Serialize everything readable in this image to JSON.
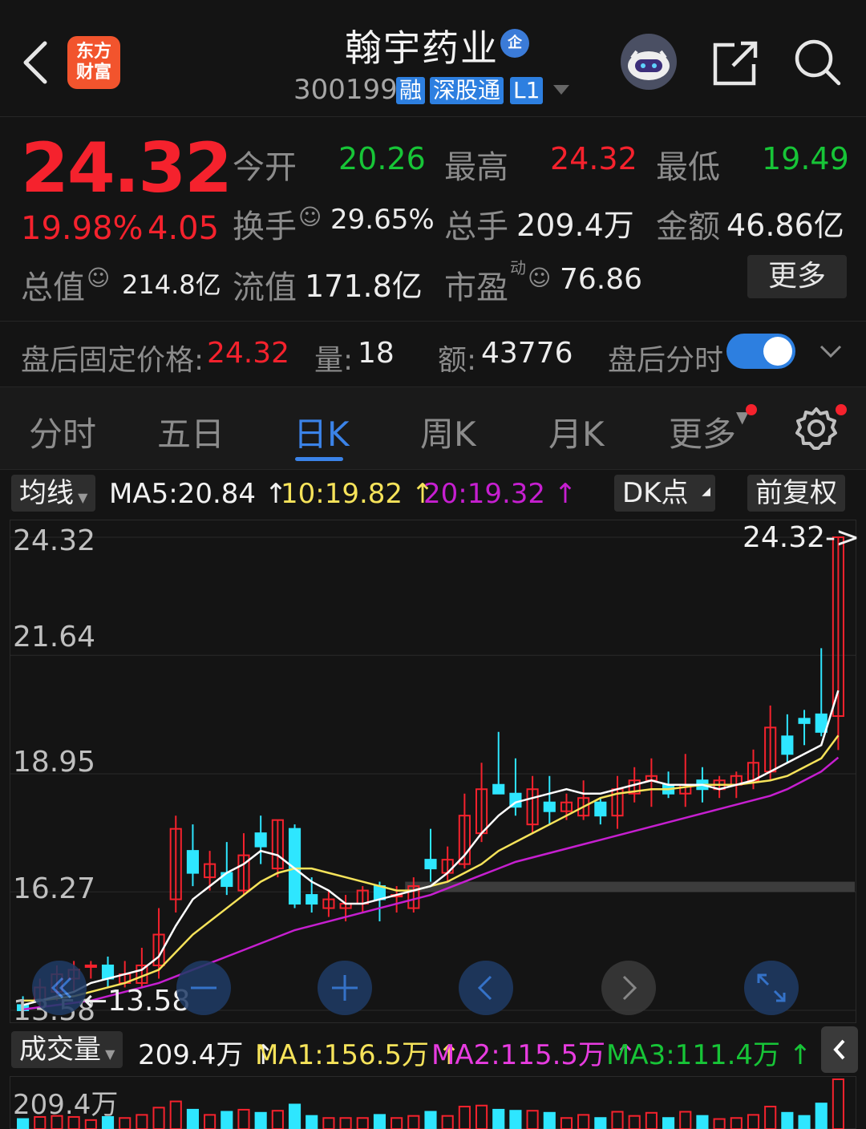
{
  "header": {
    "stock_name": "翰宇药业",
    "qi_badge": "企",
    "code": "300199",
    "tags": [
      "融",
      "深股通",
      "L1"
    ],
    "logo_line1": "东方",
    "logo_line2": "财富"
  },
  "quote": {
    "price": "24.32",
    "change_pct": "19.98%",
    "change": "4.05",
    "open_label": "今开",
    "open": "20.26",
    "high_label": "最高",
    "high": "24.32",
    "low_label": "最低",
    "low": "19.49",
    "turnover_label": "换手",
    "turnover": "29.65%",
    "volume_label": "总手",
    "volume": "209.4万",
    "amount_label": "金额",
    "amount": "46.86亿",
    "mktcap_label": "总值",
    "mktcap": "214.8亿",
    "float_label": "流值",
    "float": "171.8亿",
    "pe_label": "市盈",
    "pe_sup": "动",
    "pe": "76.86",
    "more": "更多"
  },
  "after_hours": {
    "label": "盘后固定价格:",
    "price": "24.32",
    "vol_label": "量:",
    "vol": "18",
    "amt_label": "额:",
    "amt": "43776",
    "toggle_label": "盘后分时",
    "toggle_on": true
  },
  "tabs": [
    "分时",
    "五日",
    "日K",
    "周K",
    "月K",
    "更多"
  ],
  "active_tab": "日K",
  "ma": {
    "selector": "均线",
    "ma5": "MA5:20.84",
    "ma10": "10:19.82",
    "ma20": "20:19.32",
    "dk": "DK点",
    "adjust": "前复权"
  },
  "colors": {
    "up": "#f5222d",
    "down": "#17c537",
    "bear_candle": "#2ee6ff",
    "ma5": "#ffffff",
    "ma10": "#f6e35a",
    "ma20": "#c61fd0",
    "accent": "#2d7fe0"
  },
  "chart_data": {
    "type": "candlestick",
    "y_ticks": [
      "24.32",
      "21.64",
      "18.95",
      "16.27",
      "13.58"
    ],
    "ylim": [
      13.58,
      24.32
    ],
    "last_label": "24.32->",
    "low_label": "13.58",
    "candles": [
      {
        "o": 13.7,
        "h": 13.9,
        "l": 13.4,
        "c": 13.58
      },
      {
        "o": 13.8,
        "h": 14.3,
        "l": 13.6,
        "c": 14.1
      },
      {
        "o": 14.0,
        "h": 14.6,
        "l": 13.8,
        "c": 14.4
      },
      {
        "o": 14.3,
        "h": 14.7,
        "l": 14.0,
        "c": 14.5
      },
      {
        "o": 14.6,
        "h": 14.7,
        "l": 14.3,
        "c": 14.6
      },
      {
        "o": 14.6,
        "h": 14.8,
        "l": 14.1,
        "c": 14.3
      },
      {
        "o": 14.2,
        "h": 14.7,
        "l": 14.1,
        "c": 14.4
      },
      {
        "o": 14.2,
        "h": 15.0,
        "l": 14.1,
        "c": 14.6
      },
      {
        "o": 14.6,
        "h": 15.9,
        "l": 14.3,
        "c": 15.3
      },
      {
        "o": 16.1,
        "h": 18.0,
        "l": 15.8,
        "c": 17.7
      },
      {
        "o": 17.2,
        "h": 17.8,
        "l": 16.4,
        "c": 16.7
      },
      {
        "o": 16.6,
        "h": 17.2,
        "l": 16.3,
        "c": 16.9
      },
      {
        "o": 16.7,
        "h": 17.4,
        "l": 16.2,
        "c": 16.4
      },
      {
        "o": 16.3,
        "h": 17.6,
        "l": 16.2,
        "c": 17.1
      },
      {
        "o": 17.6,
        "h": 18.0,
        "l": 16.9,
        "c": 17.3
      },
      {
        "o": 16.8,
        "h": 17.9,
        "l": 16.6,
        "c": 17.9
      },
      {
        "o": 17.7,
        "h": 17.8,
        "l": 15.9,
        "c": 16.0
      },
      {
        "o": 16.2,
        "h": 16.6,
        "l": 15.8,
        "c": 16.0
      },
      {
        "o": 15.9,
        "h": 16.3,
        "l": 15.7,
        "c": 16.1
      },
      {
        "o": 15.9,
        "h": 16.2,
        "l": 15.6,
        "c": 16.0
      },
      {
        "o": 16.0,
        "h": 16.4,
        "l": 15.8,
        "c": 16.3
      },
      {
        "o": 16.4,
        "h": 16.5,
        "l": 15.6,
        "c": 16.1
      },
      {
        "o": 16.2,
        "h": 16.4,
        "l": 15.8,
        "c": 16.2
      },
      {
        "o": 15.9,
        "h": 16.6,
        "l": 15.8,
        "c": 16.4
      },
      {
        "o": 17.0,
        "h": 17.7,
        "l": 16.5,
        "c": 16.8
      },
      {
        "o": 16.7,
        "h": 17.3,
        "l": 16.5,
        "c": 17.0
      },
      {
        "o": 16.9,
        "h": 18.5,
        "l": 16.8,
        "c": 18.0
      },
      {
        "o": 17.6,
        "h": 19.2,
        "l": 17.4,
        "c": 18.6
      },
      {
        "o": 18.7,
        "h": 19.9,
        "l": 18.5,
        "c": 18.5
      },
      {
        "o": 18.5,
        "h": 19.3,
        "l": 18.0,
        "c": 18.2
      },
      {
        "o": 17.8,
        "h": 18.9,
        "l": 17.6,
        "c": 18.6
      },
      {
        "o": 18.3,
        "h": 18.9,
        "l": 17.8,
        "c": 18.1
      },
      {
        "o": 18.1,
        "h": 18.5,
        "l": 17.9,
        "c": 18.3
      },
      {
        "o": 18.0,
        "h": 18.8,
        "l": 17.9,
        "c": 18.4
      },
      {
        "o": 18.3,
        "h": 18.4,
        "l": 17.8,
        "c": 18.0
      },
      {
        "o": 18.0,
        "h": 18.9,
        "l": 17.7,
        "c": 18.6
      },
      {
        "o": 18.5,
        "h": 19.1,
        "l": 18.3,
        "c": 18.8
      },
      {
        "o": 18.8,
        "h": 19.3,
        "l": 18.2,
        "c": 18.9
      },
      {
        "o": 18.7,
        "h": 19.0,
        "l": 18.4,
        "c": 18.5
      },
      {
        "o": 18.5,
        "h": 19.4,
        "l": 18.2,
        "c": 18.7
      },
      {
        "o": 18.8,
        "h": 19.1,
        "l": 18.3,
        "c": 18.6
      },
      {
        "o": 18.6,
        "h": 18.9,
        "l": 18.4,
        "c": 18.8
      },
      {
        "o": 18.7,
        "h": 19.0,
        "l": 18.4,
        "c": 18.9
      },
      {
        "o": 18.8,
        "h": 19.5,
        "l": 18.6,
        "c": 19.2
      },
      {
        "o": 19.0,
        "h": 20.5,
        "l": 18.8,
        "c": 20.0
      },
      {
        "o": 19.8,
        "h": 20.3,
        "l": 19.2,
        "c": 19.4
      },
      {
        "o": 20.2,
        "h": 20.4,
        "l": 19.6,
        "c": 20.1
      },
      {
        "o": 20.3,
        "h": 21.8,
        "l": 19.8,
        "c": 19.9
      },
      {
        "o": 20.26,
        "h": 24.32,
        "l": 19.49,
        "c": 24.32
      }
    ],
    "ma5": [
      13.7,
      13.8,
      13.9,
      14.0,
      14.2,
      14.3,
      14.4,
      14.5,
      14.8,
      15.5,
      16.1,
      16.4,
      16.7,
      16.9,
      17.2,
      17.1,
      16.8,
      16.5,
      16.3,
      16.0,
      16.0,
      16.1,
      16.2,
      16.3,
      16.4,
      16.7,
      17.1,
      17.6,
      18.0,
      18.3,
      18.4,
      18.5,
      18.6,
      18.5,
      18.5,
      18.6,
      18.7,
      18.8,
      18.7,
      18.7,
      18.7,
      18.6,
      18.7,
      18.8,
      19.0,
      19.2,
      19.4,
      19.6,
      20.84
    ],
    "ma10": [
      13.8,
      13.8,
      13.85,
      13.9,
      14.0,
      14.1,
      14.2,
      14.35,
      14.5,
      14.9,
      15.3,
      15.6,
      15.9,
      16.2,
      16.5,
      16.7,
      16.8,
      16.8,
      16.7,
      16.6,
      16.5,
      16.4,
      16.3,
      16.3,
      16.4,
      16.5,
      16.7,
      16.9,
      17.2,
      17.4,
      17.6,
      17.8,
      18.0,
      18.2,
      18.4,
      18.5,
      18.55,
      18.6,
      18.6,
      18.65,
      18.7,
      18.7,
      18.7,
      18.75,
      18.8,
      18.9,
      19.1,
      19.3,
      19.82
    ],
    "ma20": [
      13.6,
      13.65,
      13.7,
      13.75,
      13.8,
      13.9,
      14.0,
      14.1,
      14.2,
      14.35,
      14.5,
      14.65,
      14.8,
      14.95,
      15.1,
      15.25,
      15.4,
      15.5,
      15.6,
      15.7,
      15.8,
      15.9,
      16.0,
      16.1,
      16.2,
      16.35,
      16.5,
      16.65,
      16.8,
      16.95,
      17.05,
      17.15,
      17.25,
      17.35,
      17.45,
      17.55,
      17.65,
      17.75,
      17.85,
      17.95,
      18.05,
      18.15,
      18.25,
      18.35,
      18.45,
      18.6,
      18.8,
      19.0,
      19.32
    ],
    "resistance_band": [
      16.27,
      16.5
    ]
  },
  "controls": [
    "back-step",
    "zoom-out",
    "zoom-in",
    "prev",
    "next",
    "fullscreen"
  ],
  "volume": {
    "selector": "成交量",
    "value": "209.4万",
    "ma1": "MA1:156.5万",
    "ma2": "MA2:115.5万",
    "ma3": "MA3:111.4万",
    "max_label": "209.4万"
  }
}
